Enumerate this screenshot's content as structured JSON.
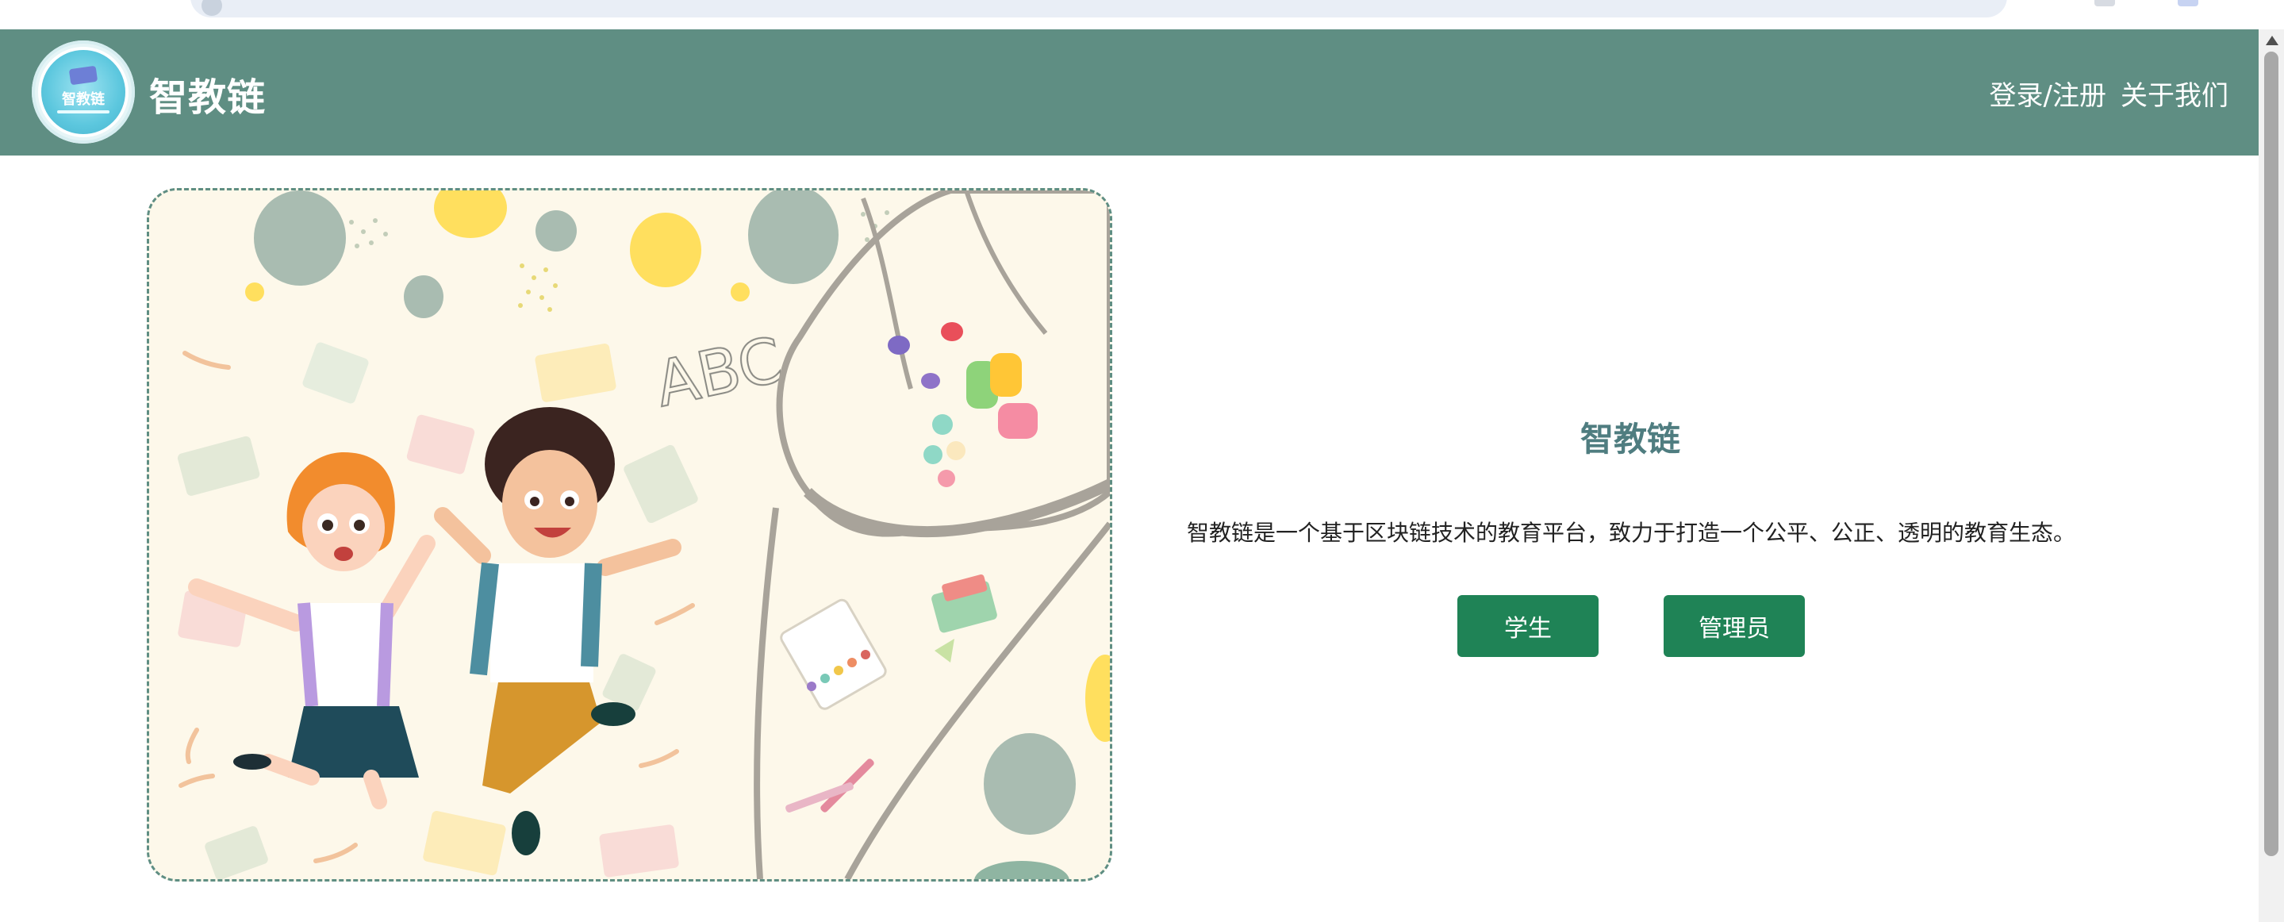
{
  "header": {
    "brand": "智教链",
    "logo_text": "智教链",
    "nav": [
      {
        "label": "登录/注册"
      },
      {
        "label": "关于我们"
      }
    ],
    "background_color": "#5f8e83"
  },
  "main": {
    "title": "智教链",
    "description": "智教链是一个基于区块链技术的教育平台，致力于打造一个公平、公正、透明的教育生态。",
    "buttons": [
      {
        "label": "学生"
      },
      {
        "label": "管理员"
      }
    ],
    "button_color": "#1f8356",
    "title_color": "#4f7d80"
  },
  "illustration": {
    "lettering": "ABC",
    "icon": "kids-jumping-illustration"
  }
}
